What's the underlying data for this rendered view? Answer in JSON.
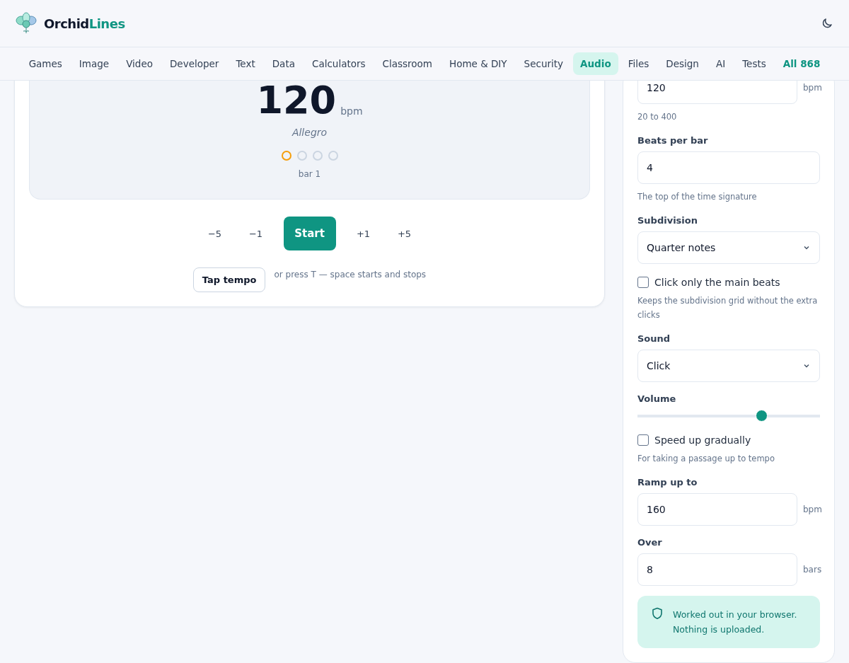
{
  "brand": {
    "first": "Orchid",
    "second": "Lines"
  },
  "nav": [
    {
      "label": "Games",
      "selected": false,
      "kind": "category"
    },
    {
      "label": "Image",
      "selected": false,
      "kind": "category"
    },
    {
      "label": "Video",
      "selected": false,
      "kind": "category"
    },
    {
      "label": "Developer",
      "selected": false,
      "kind": "category"
    },
    {
      "label": "Text",
      "selected": false,
      "kind": "category"
    },
    {
      "label": "Data",
      "selected": false,
      "kind": "category"
    },
    {
      "label": "Calculators",
      "selected": false,
      "kind": "category"
    },
    {
      "label": "Classroom",
      "selected": false,
      "kind": "category"
    },
    {
      "label": "Home & DIY",
      "selected": false,
      "kind": "category"
    },
    {
      "label": "Security",
      "selected": false,
      "kind": "category"
    },
    {
      "label": "Audio",
      "selected": true,
      "kind": "category"
    },
    {
      "label": "Files",
      "selected": false,
      "kind": "category"
    },
    {
      "label": "Design",
      "selected": false,
      "kind": "category"
    },
    {
      "label": "AI",
      "selected": false,
      "kind": "category"
    },
    {
      "label": "Tests",
      "selected": false,
      "kind": "category"
    },
    {
      "label": "All 868",
      "selected": false,
      "kind": "all"
    }
  ],
  "display": {
    "tempo": "120",
    "unit": "bpm",
    "marking": "Allegro",
    "beats": [
      {
        "active": true
      },
      {
        "active": false
      },
      {
        "active": false
      },
      {
        "active": false
      }
    ],
    "bar": "bar 1"
  },
  "controls": [
    "−5",
    "−1",
    "Start",
    "+1",
    "+5"
  ],
  "tap": {
    "button": "Tap tempo",
    "hint": "or press T — space starts and stops"
  },
  "settings": [
    {
      "kind": "number",
      "value": "120",
      "unit": "bpm",
      "help": "20 to 400"
    },
    {
      "kind": "number",
      "label": "Beats per bar",
      "value": "4",
      "help": "The top of the time signature"
    },
    {
      "kind": "select",
      "label": "Subdivision",
      "value": "Quarter notes"
    },
    {
      "kind": "checkbox",
      "label": "Click only the main beats",
      "checked": false,
      "help": "Keeps the subdivision grid without the extra clicks"
    },
    {
      "kind": "select",
      "label": "Sound",
      "value": "Click"
    },
    {
      "kind": "slider",
      "label": "Volume",
      "level": 0.68
    },
    {
      "kind": "checkbox",
      "label": "Speed up gradually",
      "checked": false,
      "help": "For taking a passage up to tempo"
    },
    {
      "kind": "number",
      "label": "Ramp up to",
      "value": "160",
      "unit": "bpm"
    },
    {
      "kind": "number",
      "label": "Over",
      "value": "8",
      "unit": "bars"
    }
  ],
  "notice": [
    "Worked out in your browser.",
    "Nothing is uploaded."
  ]
}
